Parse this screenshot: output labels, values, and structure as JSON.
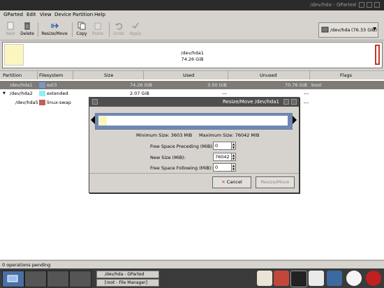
{
  "window": {
    "title": "/dev/hda - GParted"
  },
  "menu": [
    "GParted",
    "Edit",
    "View",
    "Device",
    "Partition",
    "Help"
  ],
  "toolbar": {
    "new": "New",
    "delete": "Delete",
    "resize": "Resize/Move",
    "copy": "Copy",
    "paste": "Paste",
    "undo": "Undo",
    "apply": "Apply"
  },
  "device": {
    "label": "/dev/hda",
    "size": "(76.33 GiB)"
  },
  "diskmap": {
    "name": "/dev/hda1",
    "size": "74.26 GiB"
  },
  "columns": [
    "Partition",
    "Filesystem",
    "Size",
    "Used",
    "Unused",
    "Flags"
  ],
  "rows": [
    {
      "partition": "/dev/hda1",
      "filesystem": "ext3",
      "size": "74.26 GiB",
      "used": "3.50 GiB",
      "unused": "70.76 GiB",
      "flags": "boot",
      "color": "#7a96c8"
    },
    {
      "partition": "/dev/hda2",
      "filesystem": "extended",
      "size": "2.07 GiB",
      "used": "---",
      "unused": "---",
      "flags": "",
      "color": "#8ef0f0"
    },
    {
      "partition": "/dev/hda5",
      "filesystem": "linux-swap",
      "size": "",
      "used": "",
      "unused": "---",
      "flags": "",
      "color": "#c0605b"
    }
  ],
  "dialog": {
    "title": "Resize/Move /dev/hda1",
    "min_size": "Minimum Size: 3603 MiB",
    "max_size": "Maximum Size: 76042 MiB",
    "preceding_label": "Free Space Preceding (MiB):",
    "preceding_value": "0",
    "newsize_label": "New Size (MiB):",
    "newsize_value": "76042",
    "following_label": "Free Space Following (MiB):",
    "following_value": "0",
    "cancel": "Cancel",
    "resize": "Resize/Move"
  },
  "status": "0 operations pending",
  "taskbar": {
    "task1": "/dev/hda - GParted",
    "task2": "[root - File Manager]"
  },
  "colors": {
    "selected_row": "#7e7b76",
    "accent_red": "#c03a2b"
  }
}
